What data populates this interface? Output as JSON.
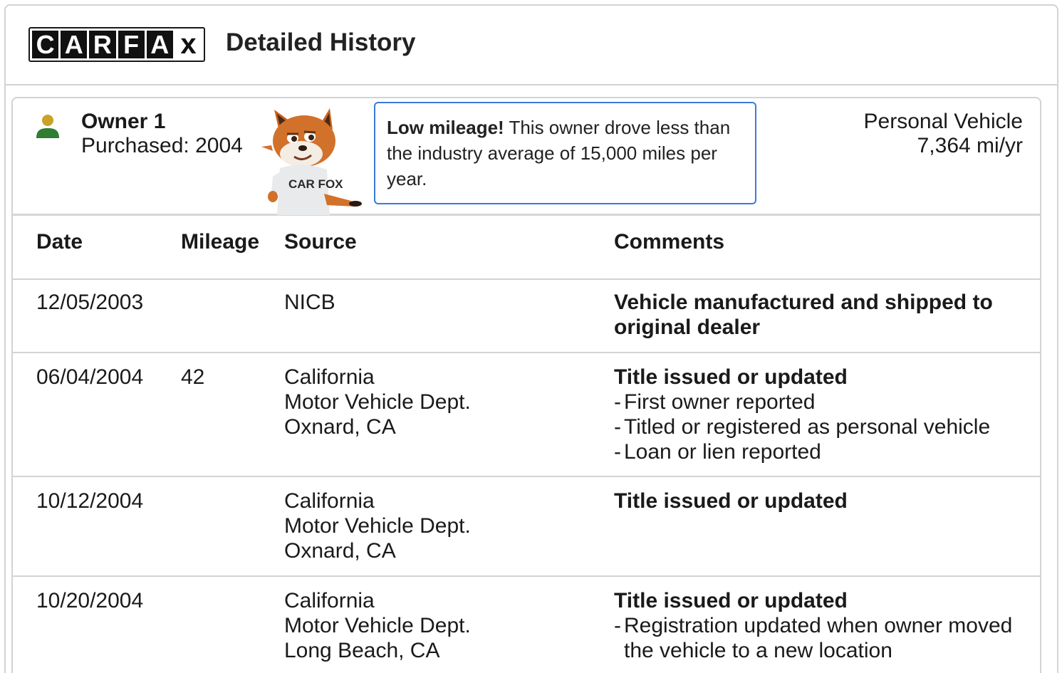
{
  "header": {
    "logo_letters": [
      "C",
      "A",
      "R",
      "F",
      "A",
      "x"
    ],
    "title": "Detailed History"
  },
  "owner": {
    "name": "Owner 1",
    "purchased": "Purchased: 2004",
    "icon": "person-icon",
    "mascot": "carfox-mascot",
    "mascot_shirt_text": "CAR FOX",
    "callout_bold": "Low mileage!",
    "callout_text": " This owner drove less than the industry average of 15,000 miles per year.",
    "vehicle_type": "Personal Vehicle",
    "vehicle_miles": "7,364 mi/yr"
  },
  "table": {
    "columns": [
      "Date",
      "Mileage",
      "Source",
      "Comments"
    ],
    "rows": [
      {
        "date": "12/05/2003",
        "mileage": "",
        "source": [
          "NICB"
        ],
        "comment_head": "Vehicle manufactured and shipped to original dealer",
        "bullets": []
      },
      {
        "date": "06/04/2004",
        "mileage": "42",
        "source": [
          "California",
          "Motor Vehicle Dept.",
          "Oxnard, CA"
        ],
        "comment_head": "Title issued or updated",
        "bullets": [
          "First owner reported",
          "Titled or registered as personal vehicle",
          "Loan or lien reported"
        ]
      },
      {
        "date": "10/12/2004",
        "mileage": "",
        "source": [
          "California",
          "Motor Vehicle Dept.",
          "Oxnard, CA"
        ],
        "comment_head": "Title issued or updated",
        "bullets": []
      },
      {
        "date": "10/20/2004",
        "mileage": "",
        "source": [
          "California",
          "Motor Vehicle Dept.",
          "Long Beach, CA"
        ],
        "comment_head": "Title issued or updated",
        "bullets": [
          "Registration updated when owner moved the vehicle to a new location"
        ]
      }
    ]
  },
  "colors": {
    "person_head": "#c9a227",
    "person_body": "#2e7d32",
    "callout_border": "#3a7bd5",
    "divider": "#d3d3d3"
  }
}
